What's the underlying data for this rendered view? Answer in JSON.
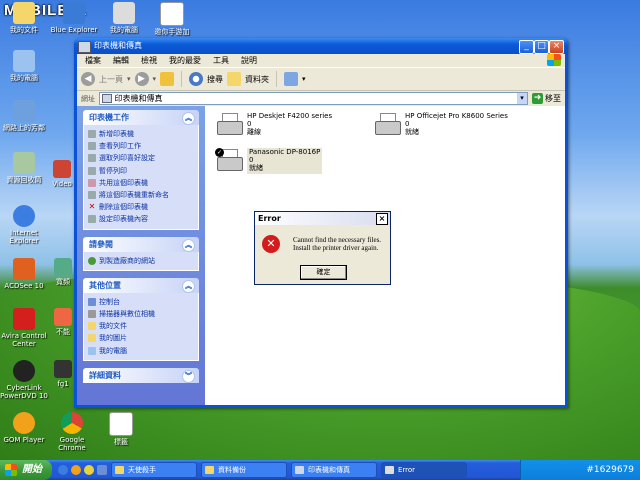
{
  "watermark": "MOBILE01",
  "desktop": {
    "icons": [
      {
        "label": "我的文件"
      },
      {
        "label": "我的電腦"
      },
      {
        "label": "網路上的芳鄰"
      },
      {
        "label": "資源回收筒"
      },
      {
        "label": "Internet Explorer"
      },
      {
        "label": "ACDSee 10"
      },
      {
        "label": "Avira Control Center"
      },
      {
        "label": "CyberLink PowerDVD 10"
      },
      {
        "label": "GOM Player"
      },
      {
        "label": "Google Chrome"
      },
      {
        "label": "標籤"
      },
      {
        "label": "Video"
      },
      {
        "label": "fg1"
      },
      {
        "label": "寬頻"
      },
      {
        "label": "不能"
      },
      {
        "label": "Blue Explorer"
      },
      {
        "label": "我的電腦"
      },
      {
        "label": "邀你手游加"
      }
    ]
  },
  "window": {
    "title": "印表機和傳真",
    "menu": [
      "檔案",
      "編輯",
      "檢視",
      "我的最愛",
      "工具",
      "說明"
    ],
    "toolbar": {
      "back": "上一頁",
      "search": "搜尋",
      "folders": "資料夾"
    },
    "address_label": "網址",
    "address_value": "印表機和傳真",
    "go_label": "移至",
    "tasks_panel": {
      "title": "印表機工作",
      "items": [
        "新增印表機",
        "查看列印工作",
        "選取列印喜好設定",
        "暫停列印",
        "共用這個印表機",
        "將這個印表機重新命名",
        "刪除這個印表機",
        "設定印表機內容"
      ]
    },
    "see_also_panel": {
      "title": "請參閱",
      "items": [
        "到製造廠商的網站"
      ]
    },
    "other_places_panel": {
      "title": "其他位置",
      "items": [
        "控制台",
        "掃描器與數位相機",
        "我的文件",
        "我的圖片",
        "我的電腦"
      ]
    },
    "details_panel": {
      "title": "詳細資料"
    },
    "printers": [
      {
        "name": "HP Deskjet F4200 series",
        "count": "0",
        "status": "離線"
      },
      {
        "name": "HP Officejet Pro K8600 Series",
        "count": "0",
        "status": "就緒"
      },
      {
        "name": "Panasonic DP-8016P",
        "count": "0",
        "status": "就緒"
      }
    ]
  },
  "dialog": {
    "title": "Error",
    "message_line1": "Cannot find the necessary files.",
    "message_line2": "Install the printer driver again.",
    "ok_label": "確定"
  },
  "taskbar": {
    "start_label": "開始",
    "tasks": [
      "天使殺手",
      "資料備份",
      "印表機和傳真",
      "Error"
    ],
    "tray_text": "#1629679"
  }
}
